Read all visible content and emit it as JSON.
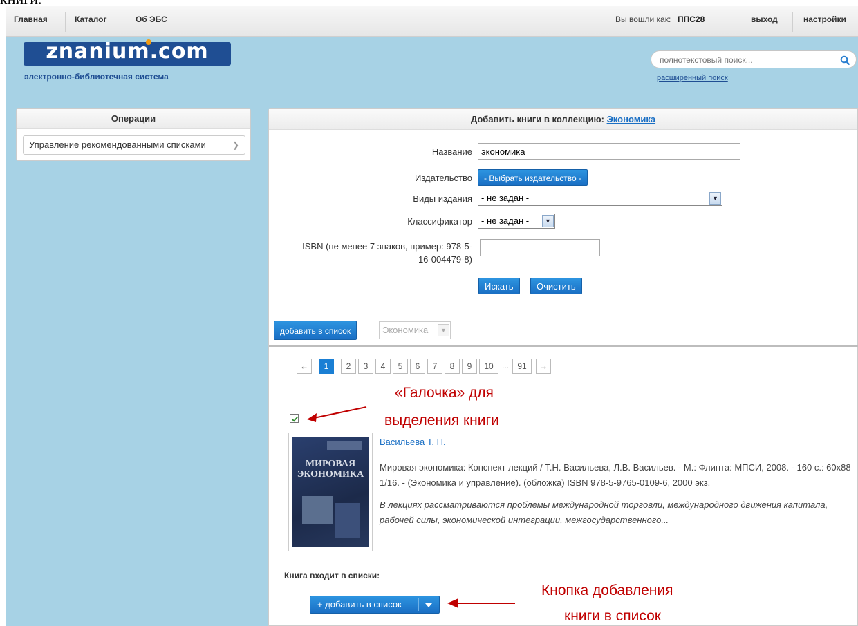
{
  "clipped_heading": "книги.",
  "topnav": {
    "items": [
      "Главная",
      "Каталог",
      "Об ЭБС"
    ],
    "logged_in_as": "Вы вошли как:",
    "username": "ППС28",
    "logout": "выход",
    "settings": "настройки"
  },
  "header": {
    "logo": "znanium.com",
    "tagline": "электронно-библиотечная система",
    "search_placeholder": "полнотекстовый поиск...",
    "advanced_search": "расширенный поиск"
  },
  "sidebar": {
    "title": "Операции",
    "items": [
      "Управление рекомендованными списками"
    ]
  },
  "main": {
    "title_prefix": "Добавить книги в коллекцию:",
    "collection_link": "Экономика",
    "form": {
      "name_label": "Название",
      "name_value": "экономика",
      "publisher_label": "Издательство",
      "publisher_button": "- Выбрать издательство -",
      "edition_label": "Виды издания",
      "edition_value": "- не задан -",
      "classifier_label": "Классификатор",
      "classifier_value": "- не задан -",
      "isbn_label_line1": "ISBN (не менее 7 знаков, пример: 978-5-",
      "isbn_label_line2": "16-004479-8)",
      "isbn_value": "",
      "search_button": "Искать",
      "clear_button": "Очистить"
    },
    "add_to_list_button": "добавить в список",
    "list_select_value": "Экономика",
    "pager": {
      "prev": "←",
      "pages": [
        "1",
        "2",
        "3",
        "4",
        "5",
        "6",
        "7",
        "8",
        "9",
        "10"
      ],
      "ellipsis": "...",
      "last": "91",
      "next": "→",
      "current": "1"
    },
    "book": {
      "checked": true,
      "cover_title": "МИРОВАЯ ЭКОНОМИКА",
      "author": "Васильева Т. Н.",
      "description": "Мировая экономика: Конспект лекций / Т.Н. Васильева, Л.В. Васильев. - М.: Флинта: МПСИ, 2008. - 160 с.: 60x88 1/16. - (Экономика и управление). (обложка) ISBN 978-5-9765-0109-6, 2000 экз.",
      "abstract": "В лекциях рассматриваются проблемы международной торговли, международного движения капитала, рабочей силы, экономической интеграции, межгосударственного...",
      "in_lists_label": "Книга входит в списки:",
      "add_button": "+ добавить в список"
    }
  },
  "annotations": {
    "checkbox_line1": "«Галочка» для",
    "checkbox_line2": "выделения книги",
    "button_line1": "Кнопка добавления",
    "button_line2": "книги в список",
    "color": "#c00000"
  }
}
